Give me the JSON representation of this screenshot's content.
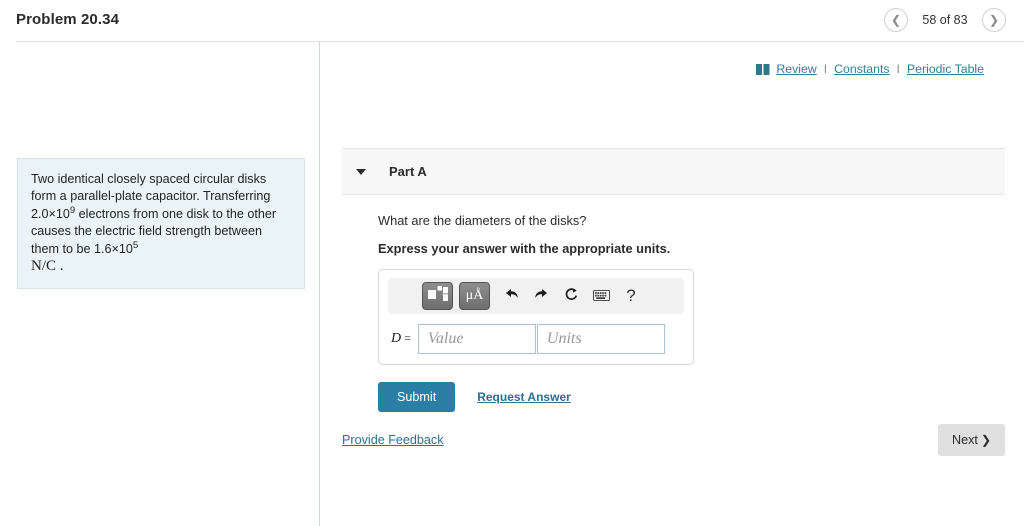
{
  "header": {
    "problem_title": "Problem 20.34",
    "pager": {
      "prev_icon": "chevron-left-icon",
      "next_icon": "chevron-right-icon",
      "count_text": "58 of 83",
      "current": 58,
      "total": 83
    }
  },
  "problem": {
    "text_part1": "Two identical closely spaced circular disks form a parallel-plate capacitor. Transferring 2.0×10",
    "exp1": "9",
    "text_part2": " electrons from one disk to the other causes the electric field strength between them to be 1.6×10",
    "exp2": "5",
    "units": "N/C .",
    "background_color": "#eaf4f6"
  },
  "resources": {
    "book_icon": "book-icon",
    "review_label": "Review",
    "constants_label": "Constants",
    "periodic_label": "Periodic Table",
    "separator": "I",
    "link_color": "#2f7f93"
  },
  "part": {
    "caret_icon": "caret-down-icon",
    "label": "Part A",
    "question": "What are the diameters of the disks?",
    "instruction": "Express your answer with the appropriate units."
  },
  "answer_widget": {
    "toolbar": {
      "template_button": "math-template-icon",
      "units_button_label": "μÅ",
      "undo_icon": "undo-arrow-icon",
      "redo_icon": "redo-arrow-icon",
      "reset_icon": "reset-circular-arrow-icon",
      "keyboard_icon": "keyboard-icon",
      "help_label": "?"
    },
    "variable_label": "D",
    "equals_sign": "=",
    "value_placeholder": "Value",
    "units_placeholder": "Units",
    "value_current": "",
    "units_current": ""
  },
  "actions": {
    "submit_label": "Submit",
    "submit_color": "#2b7ea6",
    "request_answer_label": "Request Answer"
  },
  "footer": {
    "feedback_label": "Provide Feedback",
    "next_label": "Next",
    "next_chevron": "❯"
  }
}
